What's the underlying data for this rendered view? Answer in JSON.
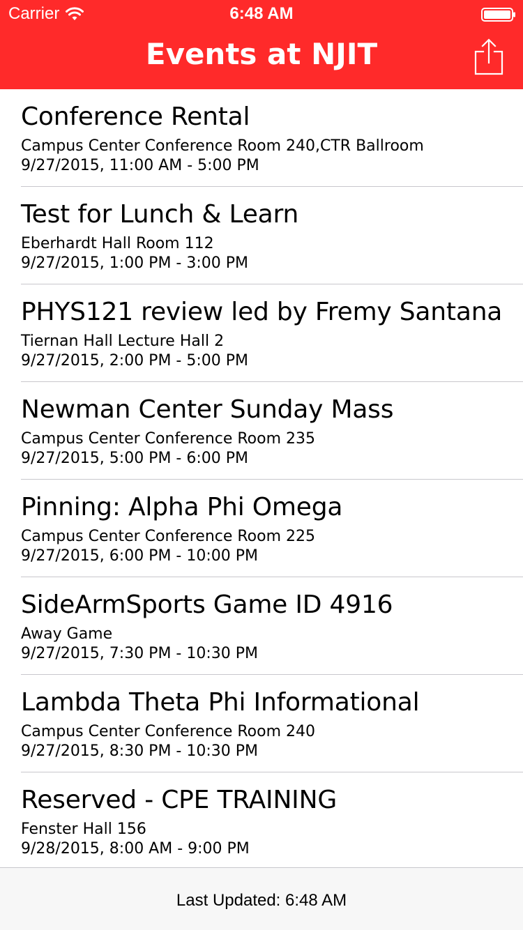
{
  "status_bar": {
    "carrier": "Carrier",
    "time": "6:48 AM",
    "icons": [
      "wifi-icon",
      "battery-icon"
    ]
  },
  "nav_bar": {
    "title": "Events at NJIT",
    "share_icon": "share-icon",
    "background_color": "#ff2a2a"
  },
  "events": [
    {
      "title": "Conference Rental",
      "location": "Campus Center Conference Room 240,CTR Ballroom",
      "time": "9/27/2015, 11:00 AM - 5:00 PM"
    },
    {
      "title": "Test for Lunch & Learn",
      "location": "Eberhardt Hall Room 112",
      "time": "9/27/2015, 1:00 PM - 3:00 PM"
    },
    {
      "title": "PHYS121 review led by Fremy Santana",
      "location": "Tiernan Hall Lecture Hall 2",
      "time": "9/27/2015, 2:00 PM - 5:00 PM"
    },
    {
      "title": "Newman Center Sunday Mass",
      "location": "Campus Center Conference Room 235",
      "time": "9/27/2015, 5:00 PM - 6:00 PM"
    },
    {
      "title": "Pinning: Alpha Phi Omega",
      "location": "Campus Center Conference Room 225",
      "time": "9/27/2015, 6:00 PM - 10:00 PM"
    },
    {
      "title": "SideArmSports Game ID 4916",
      "location": "Away Game",
      "time": "9/27/2015, 7:30 PM - 10:30 PM"
    },
    {
      "title": "Lambda Theta Phi Informational",
      "location": "Campus Center Conference Room 240",
      "time": "9/27/2015, 8:30 PM - 10:30 PM"
    },
    {
      "title": "Reserved - CPE TRAINING",
      "location": "Fenster Hall 156",
      "time": "9/28/2015, 8:00 AM - 9:00 PM"
    }
  ],
  "footer": {
    "last_updated": "Last Updated: 6:48 AM"
  }
}
